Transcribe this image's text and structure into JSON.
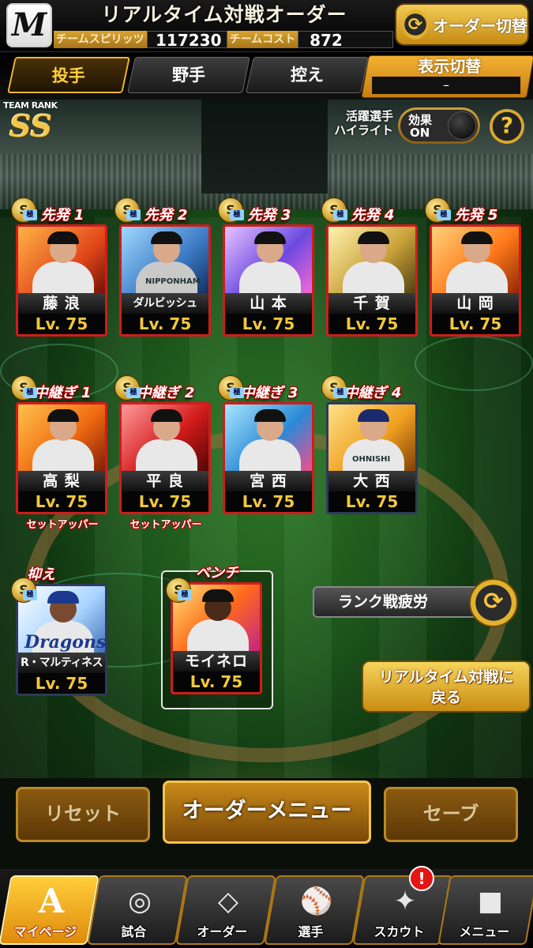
{
  "header": {
    "logo_letter": "M",
    "title": "リアルタイム対戦オーダー",
    "spirit_label": "チームスピリッツ",
    "spirit_value": "117230",
    "cost_label": "チームコスト",
    "cost_value": "872",
    "order_switch_label": "オーダー切替"
  },
  "tabs": [
    {
      "label": "投手",
      "active": true
    },
    {
      "label": "野手",
      "active": false
    },
    {
      "label": "控え",
      "active": false
    }
  ],
  "display_toggle": {
    "label": "表示切替",
    "value": "–"
  },
  "team_rank": {
    "label": "TEAM RANK",
    "value": "SS"
  },
  "highlight": {
    "label_line1": "活躍選手",
    "label_line2": "ハイライト"
  },
  "effect_toggle": {
    "label": "効果",
    "state": "ON"
  },
  "help_label": "?",
  "starters": [
    {
      "slot": "先発 1",
      "name": "藤 浪",
      "level": "Lv. 75"
    },
    {
      "slot": "先発 2",
      "name": "ダルビッシュ",
      "level": "Lv. 75"
    },
    {
      "slot": "先発 3",
      "name": "山 本",
      "level": "Lv. 75"
    },
    {
      "slot": "先発 4",
      "name": "千 賀",
      "level": "Lv. 75"
    },
    {
      "slot": "先発 5",
      "name": "山 岡",
      "level": "Lv. 75"
    }
  ],
  "relievers": [
    {
      "slot": "中継ぎ 1",
      "name": "高 梨",
      "level": "Lv. 75",
      "note": "セットアッパー"
    },
    {
      "slot": "中継ぎ 2",
      "name": "平 良",
      "level": "Lv. 75",
      "note": "セットアッパー"
    },
    {
      "slot": "中継ぎ 3",
      "name": "宮 西",
      "level": "Lv. 75",
      "note": ""
    },
    {
      "slot": "中継ぎ 4",
      "name": "大 西",
      "level": "Lv. 75",
      "note": ""
    }
  ],
  "closer": {
    "slot": "抑え",
    "name": "R・マルティネス",
    "level": "Lv. 75",
    "team_text": "Dragons"
  },
  "bench": {
    "slot": "ベンチ",
    "name": "モイネロ",
    "level": "Lv. 75"
  },
  "rarity": {
    "letter": "S",
    "sub": "極"
  },
  "jersey": {
    "starter_2": "NIPPONHAM",
    "reliever_4": "OHNISHI"
  },
  "fatigue_label": "ランク戦疲労",
  "back_button": {
    "line1": "リアルタイム対戦に",
    "line2": "戻る"
  },
  "actions": {
    "reset": "リセット",
    "order_menu": "オーダーメニュー",
    "save": "セーブ"
  },
  "bottom_nav": [
    {
      "label": "マイページ",
      "icon": "A",
      "active": true
    },
    {
      "label": "試合",
      "icon": "◎",
      "active": false
    },
    {
      "label": "オーダー",
      "icon": "◇",
      "active": false
    },
    {
      "label": "選手",
      "icon": "⚾",
      "active": false
    },
    {
      "label": "スカウト",
      "icon": "✦",
      "active": false
    },
    {
      "label": "メニュー",
      "icon": "■",
      "active": false
    }
  ],
  "notification_badge": "!",
  "colors": {
    "accent_gold": "#f0b72c",
    "card_border_red": "#d21b1b",
    "level_yellow": "#f3c83a",
    "label_red": "#b10000"
  }
}
